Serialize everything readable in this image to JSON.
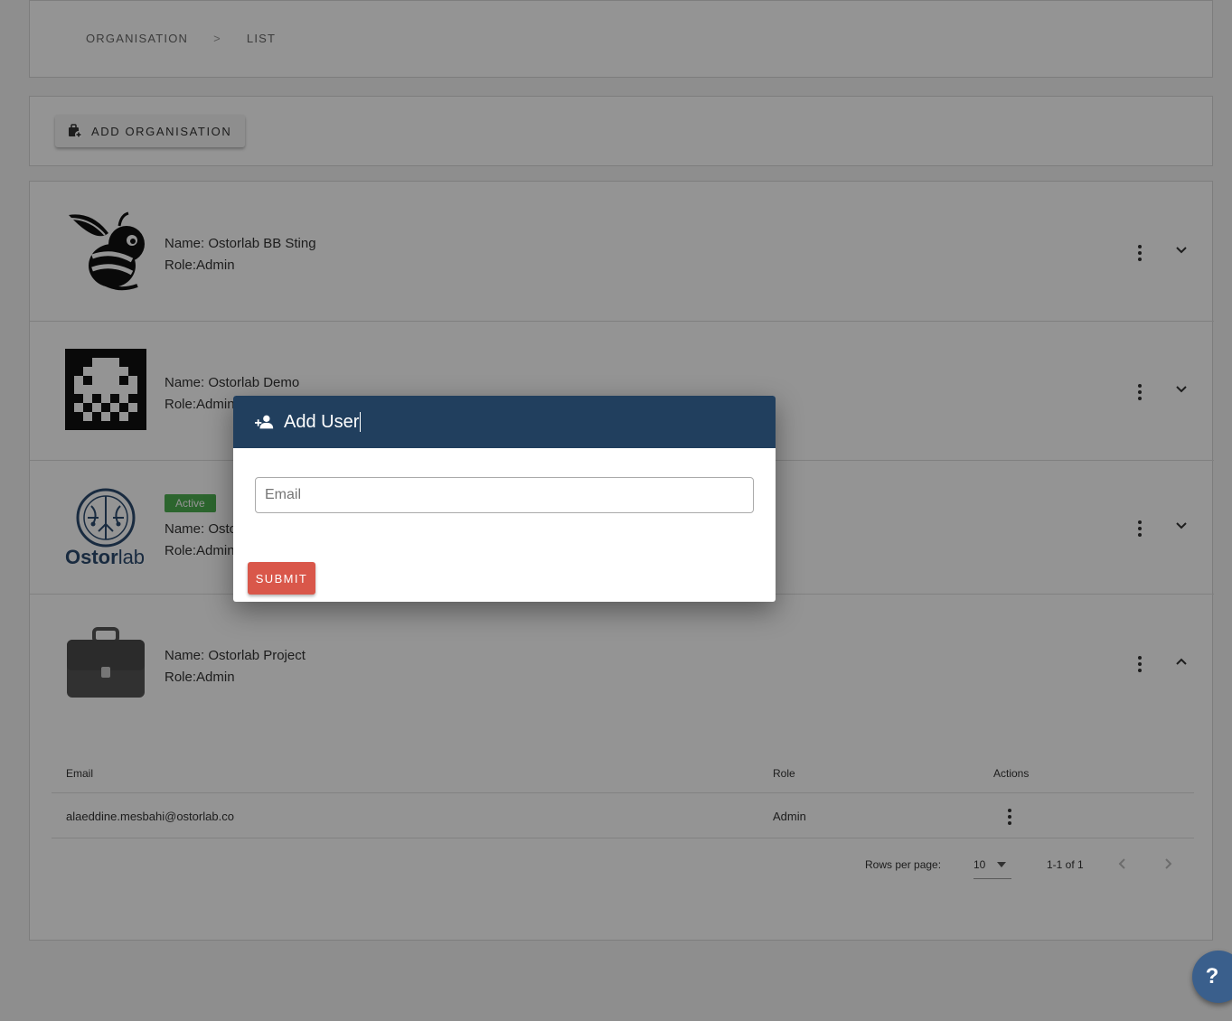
{
  "breadcrumb": {
    "items": [
      "ORGANISATION",
      "LIST"
    ],
    "separator": ">"
  },
  "toolbar": {
    "add_org_label": "ADD ORGANISATION"
  },
  "orgs": [
    {
      "name": "Name: Ostorlab BB Sting",
      "role": "Role:Admin",
      "logo": "wasp-logo",
      "expanded": false
    },
    {
      "name": "Name: Ostorlab Demo",
      "role": "Role:Admin",
      "logo": "space-invader-logo",
      "expanded": false
    },
    {
      "name": "Name: Ostorlab",
      "role": "Role:Admin",
      "badge": "Active",
      "logo": "ostorlab-logo",
      "logo_text_a": "Ostor",
      "logo_text_b": "lab",
      "expanded": false
    },
    {
      "name": "Name: Ostorlab Project",
      "role": "Role:Admin",
      "logo": "briefcase-logo",
      "expanded": true
    }
  ],
  "users_table": {
    "headers": {
      "email": "Email",
      "role": "Role",
      "actions": "Actions"
    },
    "rows": [
      {
        "email": "alaeddine.mesbahi@ostorlab.co",
        "role": "Admin"
      }
    ],
    "pagination": {
      "rows_per_page_label": "Rows per page:",
      "rows_per_page": "10",
      "range": "1-1 of 1"
    }
  },
  "dialog": {
    "title": "Add User",
    "email_placeholder": "Email",
    "email_value": "",
    "submit_label": "SUBMIT"
  },
  "help": {
    "label": "?"
  },
  "colors": {
    "dialog_header": "#213f5e",
    "submit": "#d9574a",
    "badge": "#4caf50",
    "fab": "#3a5f8c"
  }
}
